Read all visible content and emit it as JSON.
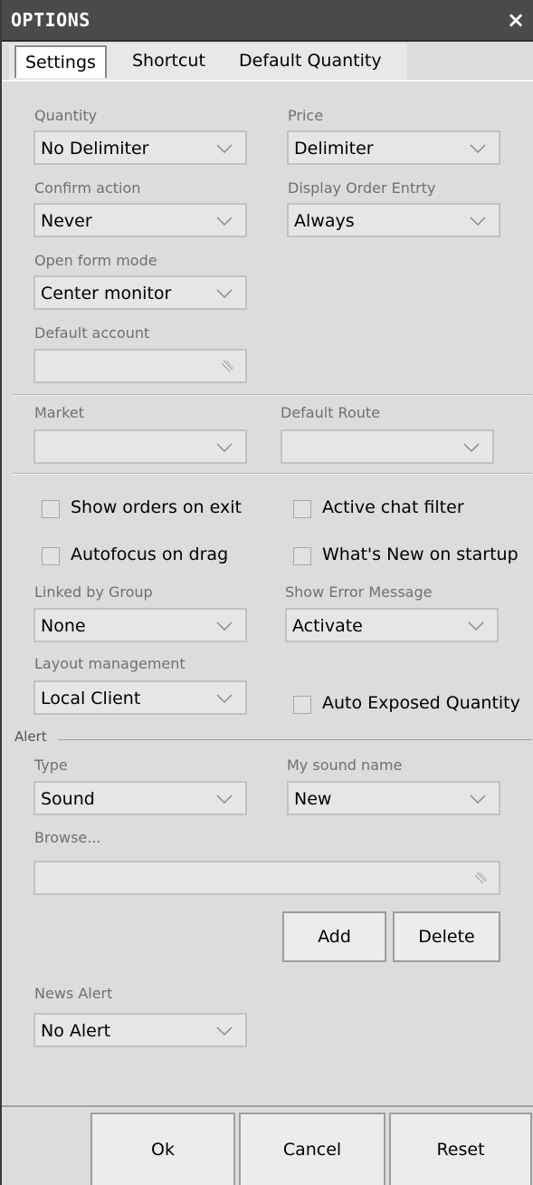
{
  "window": {
    "title": "OPTIONS",
    "close_glyph": "×"
  },
  "tabs": [
    {
      "label": "Settings",
      "active": true
    },
    {
      "label": "Shortcut",
      "active": false
    },
    {
      "label": "Default Quantity",
      "active": false
    }
  ],
  "settings": {
    "quantity": {
      "label": "Quantity",
      "value": "No Delimiter"
    },
    "price": {
      "label": "Price",
      "value": "Delimiter"
    },
    "confirm_action": {
      "label": "Confirm action",
      "value": "Never"
    },
    "display_order_entry": {
      "label": "Display Order Entrty",
      "value": "Always"
    },
    "open_form_mode": {
      "label": "Open form mode",
      "value": "Center monitor"
    },
    "default_account": {
      "label": "Default account",
      "value": ""
    },
    "market": {
      "label": "Market",
      "value": ""
    },
    "default_route": {
      "label": "Default Route",
      "value": ""
    },
    "checkboxes": [
      {
        "label": "Show orders on exit",
        "checked": false
      },
      {
        "label": "Active chat filter",
        "checked": false
      },
      {
        "label": "Autofocus on drag",
        "checked": false
      },
      {
        "label": "What's New on startup",
        "checked": false
      }
    ],
    "linked_by_group": {
      "label": "Linked by Group",
      "value": "None"
    },
    "show_error_message": {
      "label": "Show Error Message",
      "value": "Activate"
    },
    "layout_management": {
      "label": "Layout management",
      "value": "Local Client"
    },
    "auto_exposed_quantity": {
      "label": "Auto Exposed Quantity",
      "checked": false
    }
  },
  "alert": {
    "group_title": "Alert",
    "type": {
      "label": "Type",
      "value": "Sound"
    },
    "my_sound_name": {
      "label": "My sound name",
      "value": "New"
    },
    "browse": {
      "label": "Browse...",
      "value": ""
    },
    "add_label": "Add",
    "delete_label": "Delete",
    "news_alert": {
      "label": "News Alert",
      "value": "No Alert"
    }
  },
  "footer": {
    "ok_label": "Ok",
    "cancel_label": "Cancel",
    "reset_label": "Reset"
  },
  "icons": {
    "dropdown": "chevron-down-icon",
    "field_grip": "resize-grip-icon",
    "close": "close-icon"
  },
  "colors": {
    "titlebar": "#4a4a4a",
    "panel": "#dcdcdc",
    "field": "#e6e6e6",
    "label": "#707070"
  }
}
